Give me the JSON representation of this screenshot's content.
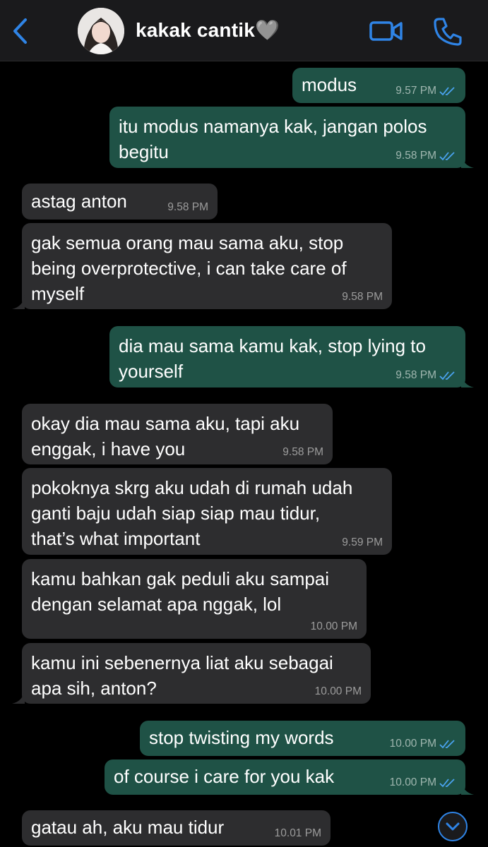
{
  "header": {
    "contact_name": "kakak cantik🩶",
    "back_icon": "chevron-left-icon",
    "video_icon": "video-camera-icon",
    "call_icon": "phone-icon",
    "accent_color": "#2f84e6"
  },
  "messages": [
    {
      "direction": "out",
      "text": "modus",
      "time": "9.57 PM",
      "read": true
    },
    {
      "direction": "out",
      "text": "itu modus namanya kak, jangan polos\nbegitu",
      "time": "9.58 PM",
      "read": true
    },
    {
      "direction": "in",
      "text": "astag anton",
      "time": "9.58 PM"
    },
    {
      "direction": "in",
      "text": "gak semua orang mau sama aku, stop\nbeing overprotective, i can take care of\nmyself",
      "time": "9.58 PM"
    },
    {
      "direction": "out",
      "text": "dia mau sama kamu kak, stop lying to\nyourself",
      "time": "9.58 PM",
      "read": true
    },
    {
      "direction": "in",
      "text": "okay dia mau sama aku, tapi aku\nenggak, i have you",
      "time": "9.58 PM"
    },
    {
      "direction": "in",
      "text": "pokoknya skrg aku udah di rumah udah\nganti baju udah siap siap mau tidur,\nthat’s what important",
      "time": "9.59 PM"
    },
    {
      "direction": "in",
      "text": "kamu bahkan gak peduli aku sampai\ndengan selamat apa nggak, lol",
      "time": "10.00 PM"
    },
    {
      "direction": "in",
      "text": "kamu ini sebenernya liat aku sebagai\napa sih, anton?",
      "time": "10.00 PM"
    },
    {
      "direction": "out",
      "text": "stop twisting my words",
      "time": "10.00 PM",
      "read": true
    },
    {
      "direction": "out",
      "text": "of course i care for you kak",
      "time": "10.00 PM",
      "read": true
    },
    {
      "direction": "in",
      "text": "gatau ah, aku mau tidur",
      "time": "10.01 PM"
    }
  ],
  "scroll_down_icon": "chevron-down-circle-icon"
}
